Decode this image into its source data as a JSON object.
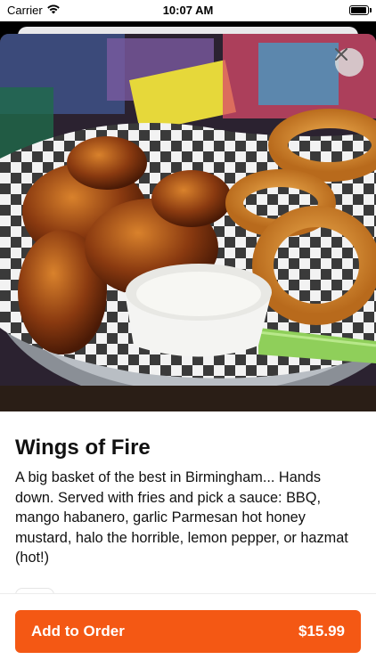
{
  "status_bar": {
    "carrier": "Carrier",
    "time": "10:07 AM"
  },
  "item": {
    "name": "Wings of Fire",
    "description": "A big basket of the best in Birmingham... Hands down. Served with fries and pick a sauce: BBQ, mango habanero, garlic Parmesan hot honey mustard, halo the horrible, lemon pepper, or hazmat (hot!)",
    "photo_alt": "basket of sauced wings, onion rings, ranch and celery"
  },
  "order": {
    "button_label": "Add to Order",
    "price": "$15.99"
  },
  "colors": {
    "accent": "#f45814"
  },
  "icons": {
    "close": "close-icon",
    "wifi": "wifi-icon",
    "battery": "battery-icon"
  }
}
